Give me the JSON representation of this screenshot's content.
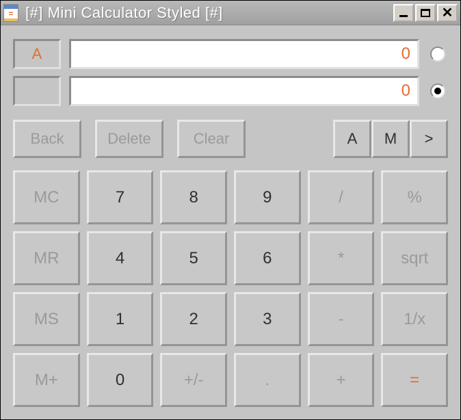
{
  "window": {
    "title": "[#] Mini Calculator Styled [#]"
  },
  "displays": {
    "labelA": "A",
    "labelB": "",
    "valueA": "0",
    "valueB": "0",
    "selected": "B"
  },
  "controls": {
    "back": "Back",
    "delete": "Delete",
    "clear": "Clear",
    "a": "A",
    "m": "M",
    "more": ">"
  },
  "keypad": {
    "mc": "MC",
    "mr": "MR",
    "ms": "MS",
    "mplus": "M+",
    "n7": "7",
    "n8": "8",
    "n9": "9",
    "n4": "4",
    "n5": "5",
    "n6": "6",
    "n1": "1",
    "n2": "2",
    "n3": "3",
    "n0": "0",
    "sign": "+/-",
    "dot": ".",
    "div": "/",
    "mul": "*",
    "sub": "-",
    "add": "+",
    "pct": "%",
    "sqrt": "sqrt",
    "inv": "1/x",
    "eq": "="
  }
}
